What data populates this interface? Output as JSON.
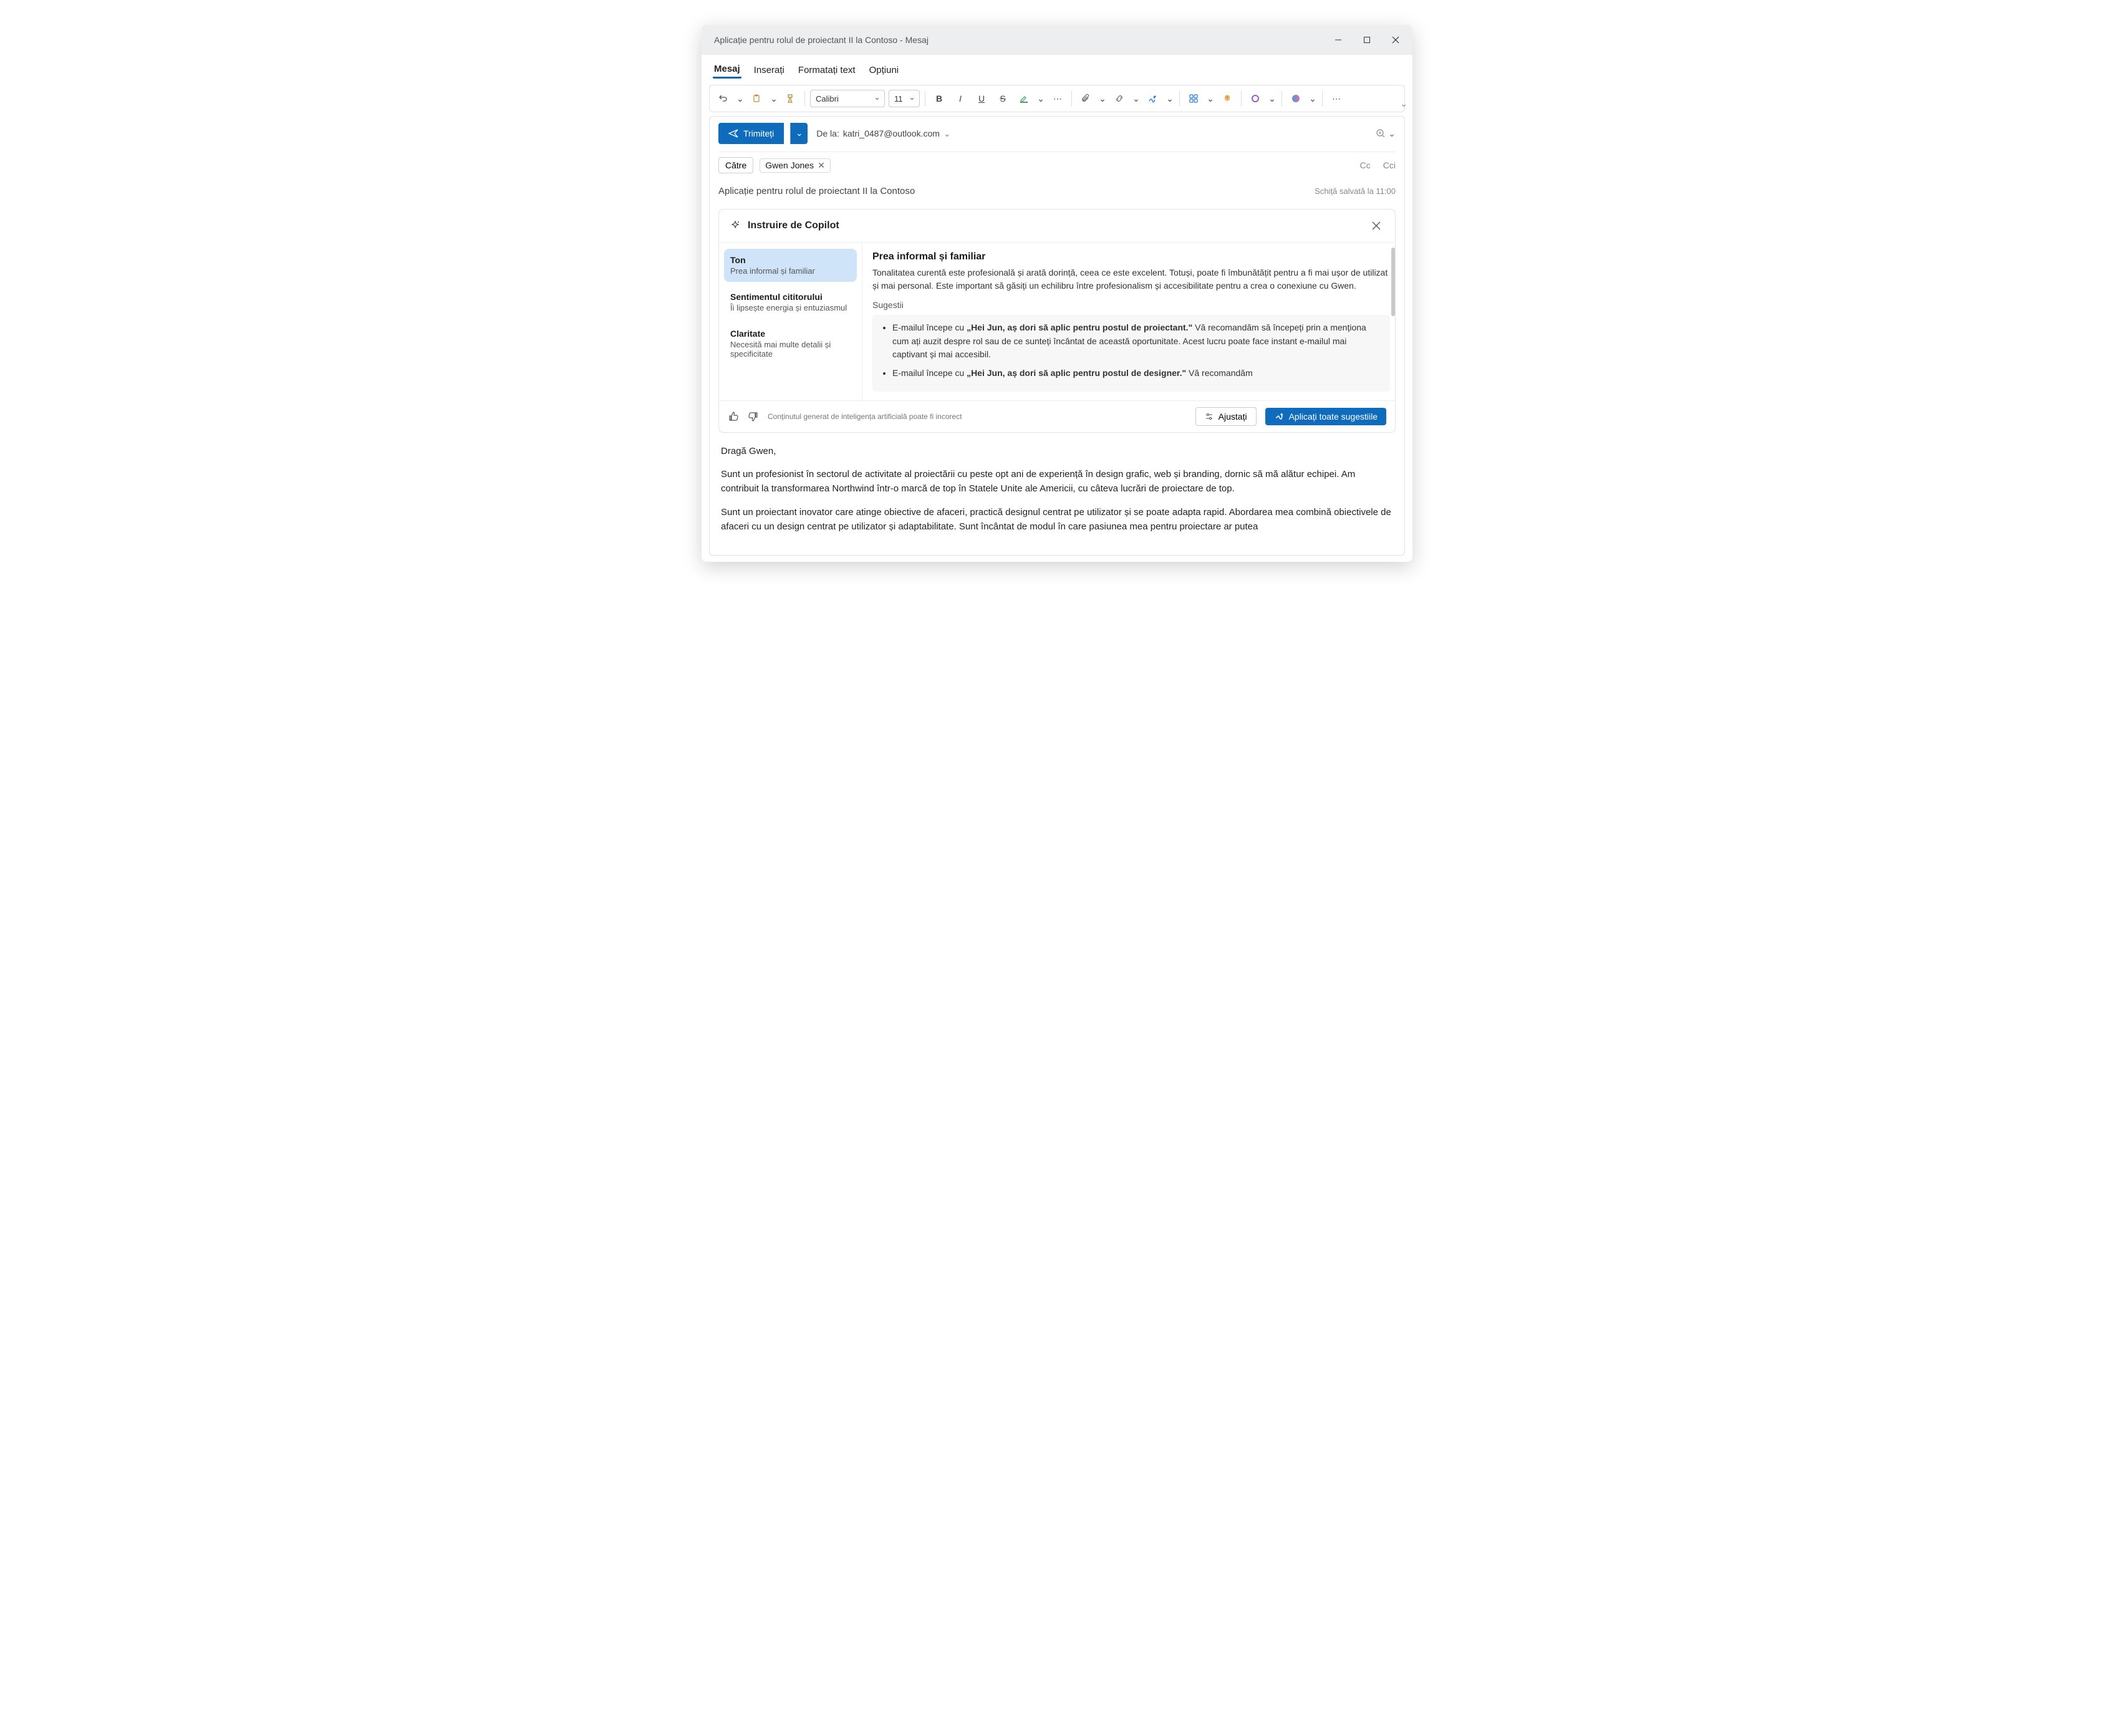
{
  "window": {
    "title": "Aplicație pentru rolul de proiectant II la Contoso - Mesaj",
    "tabs": [
      "Mesaj",
      "Inserați",
      "Formatați text",
      "Opțiuni"
    ],
    "active_tab": 0
  },
  "ribbon": {
    "font_name": "Calibri",
    "font_size": "11"
  },
  "compose": {
    "send": "Trimiteți",
    "from_label": "De la:",
    "from_email": "katri_0487@outlook.com",
    "to_label": "Către",
    "recipient": "Gwen Jones",
    "cc": "Cc",
    "bcc": "Cci",
    "subject": "Aplicație pentru rolul de proiectant II la Contoso",
    "saved": "Schiță salvată la 11:00"
  },
  "copilot": {
    "title": "Instruire de Copilot",
    "categories": [
      {
        "title": "Ton",
        "sub": "Prea informal și familiar"
      },
      {
        "title": "Sentimentul cititorului",
        "sub": "Îi lipsește energia și entuziasmul"
      },
      {
        "title": "Claritate",
        "sub": "Necesită mai multe detalii și specificitate"
      }
    ],
    "headline": "Prea informal și familiar",
    "summary": "Tonalitatea curentă este profesională și arată dorință, ceea ce este excelent. Totuși, poate fi îmbunătățit pentru a fi mai ușor de utilizat și mai personal. Este important să găsiți un echilibru între profesionalism și accesibilitate pentru a crea o conexiune cu Gwen.",
    "suggestions_label": "Sugestii",
    "suggestions": [
      {
        "prefix": "E-mailul începe cu ",
        "quote": "„Hei Jun, aș dori să aplic pentru postul de proiectant.\"",
        "rest": " Vă recomandăm să începeți prin a menționa cum ați auzit despre rol sau de ce sunteți încântat de această oportunitate. Acest lucru poate face instant e-mailul mai captivant și mai accesibil."
      },
      {
        "prefix": "E-mailul începe cu ",
        "quote": "„Hei Jun, aș dori să aplic pentru postul de designer.\"",
        "rest": " Vă recomandăm"
      }
    ],
    "disclaimer": "Conținutul generat de inteligența artificială poate fi incorect",
    "adjust": "Ajustați",
    "apply_all": "Aplicați toate sugestiile"
  },
  "email": {
    "greeting": "Dragă Gwen,",
    "p1": "Sunt un profesionist în sectorul de activitate al proiectării cu peste opt ani de experiență în design grafic, web și branding, dornic să mă alătur echipei. Am contribuit la transformarea Northwind într-o marcă de top în Statele Unite ale Americii, cu câteva lucrări de proiectare de top.",
    "p2": "Sunt un proiectant inovator care atinge obiective de afaceri, practică designul centrat pe utilizator și se poate adapta rapid. Abordarea mea combină obiectivele de afaceri cu un design centrat pe utilizator și adaptabilitate. Sunt încântat de modul în care pasiunea mea pentru proiectare ar putea"
  }
}
